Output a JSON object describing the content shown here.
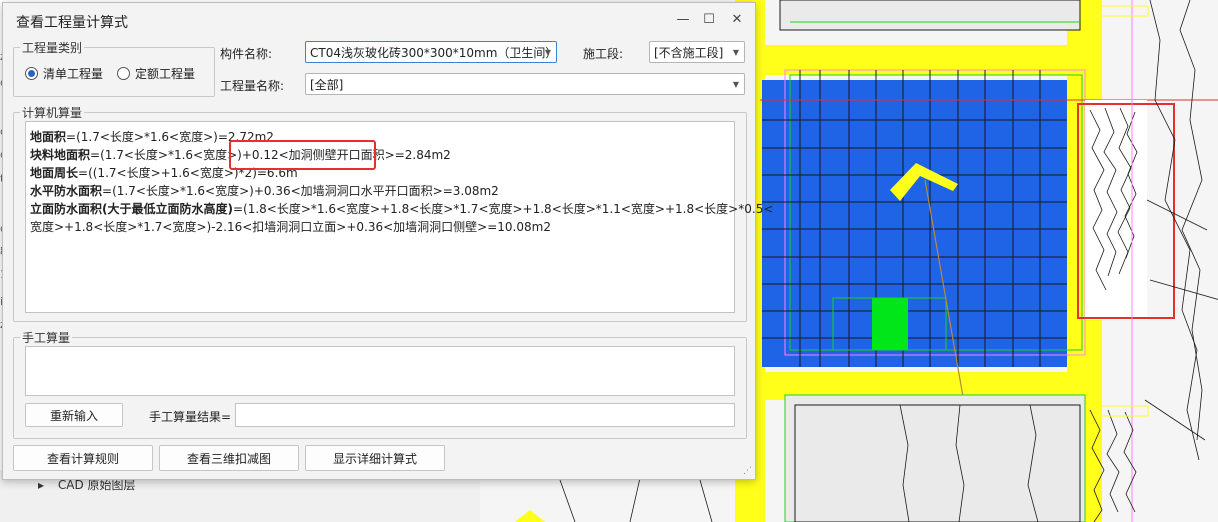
{
  "dialog": {
    "title": "查看工程量计算式",
    "window_controls": {
      "minimize": "—",
      "maximize": "☐",
      "close": "✕"
    }
  },
  "quantity_type": {
    "legend": "工程量类别",
    "options": [
      {
        "label": "清单工程量",
        "selected": true
      },
      {
        "label": "定额工程量",
        "selected": false
      }
    ]
  },
  "component": {
    "label": "构件名称:",
    "value": "CT04浅灰玻化砖300*300*10mm（卫生间）"
  },
  "construction_stage": {
    "label": "施工段:",
    "value": "[不含施工段]"
  },
  "quantity_name": {
    "label": "工程量名称:",
    "value": "[全部]"
  },
  "computer_calc": {
    "legend": "计算机算量",
    "lines": [
      {
        "name": "地面积",
        "formula": "=(1.7<长度>*1.6<宽度>)=2.72m2"
      },
      {
        "name": "块料地面积",
        "formula": "=(1.7<长度>*1.6<宽度>)+0.12<加洞侧壁开口面积>=2.84m2"
      },
      {
        "name": "地面周长",
        "formula": "=((1.7<长度>+1.6<宽度>)*2)=6.6m"
      },
      {
        "name": "水平防水面积",
        "formula": "=(1.7<长度>*1.6<宽度>)+0.36<加墙洞洞口水平开口面积>=3.08m2"
      },
      {
        "name": "立面防水面积(大于最低立面防水高度)",
        "formula": "=(1.8<长度>*1.6<宽度>+1.8<长度>*1.7<宽度>+1.8<长度>*1.1<宽度>+1.8<长度>*0.5<"
      },
      {
        "name": "",
        "formula": "宽度>+1.8<长度>*1.7<宽度>)-2.16<扣墙洞洞口立面>+0.36<加墙洞洞口侧壁>=10.08m2"
      }
    ]
  },
  "manual_calc": {
    "legend": "手工算量",
    "reenter_label": "重新输入",
    "result_label": "手工算量结果=",
    "result_value": ""
  },
  "footer_buttons": {
    "view_rules": "查看计算规则",
    "view_3d": "查看三维扣减图",
    "show_detail": "显示详细计算式"
  },
  "background": {
    "layer_label": "CAD 原始图层",
    "sidebar_glyphs": [
      "z",
      "d",
      "d",
      "d",
      "t",
      "d",
      "ξ",
      "1",
      "i",
      "z"
    ]
  },
  "colors": {
    "room_fill": "#1f63e6",
    "wall_yellow": "#ffff1a",
    "opening_green": "#00e619",
    "annotation_red": "#e53030",
    "grid_dark": "#1a1a1a"
  }
}
